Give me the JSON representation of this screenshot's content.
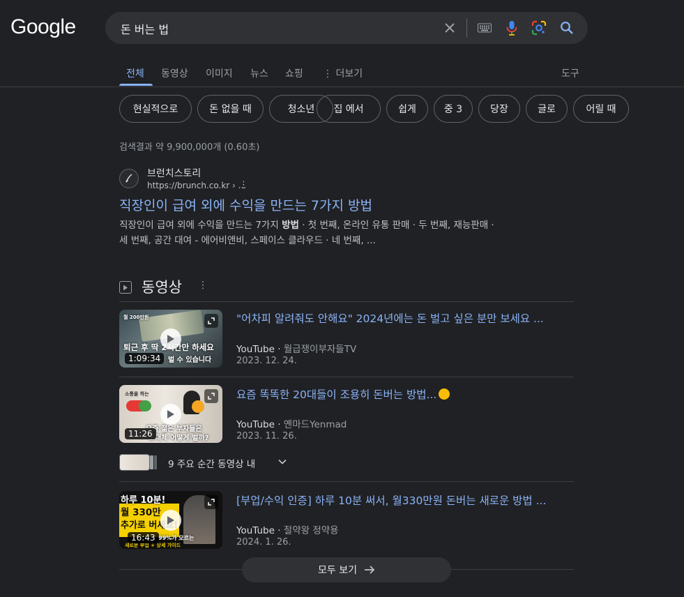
{
  "logo": "Google",
  "search": {
    "query": "돈 버는 법"
  },
  "tabs": [
    {
      "label": "전체",
      "active": true
    },
    {
      "label": "동영상"
    },
    {
      "label": "이미지"
    },
    {
      "label": "뉴스"
    },
    {
      "label": "쇼핑"
    },
    {
      "label": "더보기"
    }
  ],
  "tools_label": "도구",
  "chips": [
    "현실적으로",
    "돈 없을 때",
    "청소년",
    "집 에서",
    "쉽게",
    "중 3",
    "당장",
    "글로",
    "어릴 때"
  ],
  "result_stats": "검색결과 약 9,900,000개 (0.60초)",
  "result": {
    "site_name": "브런치스토리",
    "url": "https://brunch.co.kr › ...",
    "title": "직장인이 급여 외에 수익을 만드는 7가지 방법",
    "snippet_1a": "직장인이 급여 외에 수익을 만드는 7가지 ",
    "snippet_1b": "방법",
    "snippet_1c": " · 첫 번째, 온라인 유통 판매 · 두 번째, 재능판매 ·",
    "snippet_2": "세 번째, 공간 대여 - 에어비앤비, 스페이스 클라우드 · 네 번째, ..."
  },
  "videos_section": {
    "title": "동영상"
  },
  "videos": [
    {
      "title": "\"어차피 알려줘도 안해요\" 2024년에는 돈 벌고 싶은 분만 보세요 ...",
      "source": "YouTube",
      "channel": "월급쟁이부자들TV",
      "date": "2023. 12. 24.",
      "duration": "1:09:34",
      "thumb_text_small": "월 200만원",
      "thumb_text_main": "퇴근 후 딱 2시간만 하세요",
      "thumb_text_bottom": "벌 수 있습니다"
    },
    {
      "title": "요즘 똑똑한 20대들이 조용히 돈버는 방법...",
      "source": "YouTube",
      "channel": "옌마드Yenmad",
      "date": "2023. 11. 26.",
      "duration": "11:26",
      "thumb_text_top": "소통을 하는",
      "thumb_text_main": "요즘 젊은 부자들은",
      "thumb_text_bottom": "도대체 어떻게 벌까?"
    },
    {
      "title": "[부업/수익 인증] 하루 10분 써서, 월330만원 돈버는 새로운 방법 ...",
      "source": "YouTube",
      "channel": "절약왕 정약용",
      "date": "2024. 1. 26.",
      "duration": "16:43",
      "thumb_text_line1": "하루 10분!",
      "thumb_text_line2": "월 330만",
      "thumb_text_line3": "추가로 버세요!",
      "thumb_text_side": "99%가 모르는",
      "thumb_text_bottom": "새로운 부업 + 상세 가이드"
    }
  ],
  "key_moments": "9 주요 순간 동영상 내",
  "see_all": "모두 보기",
  "colors": {
    "background": "#202124",
    "link": "#8ab4f8",
    "text": "#bdc1c6"
  }
}
